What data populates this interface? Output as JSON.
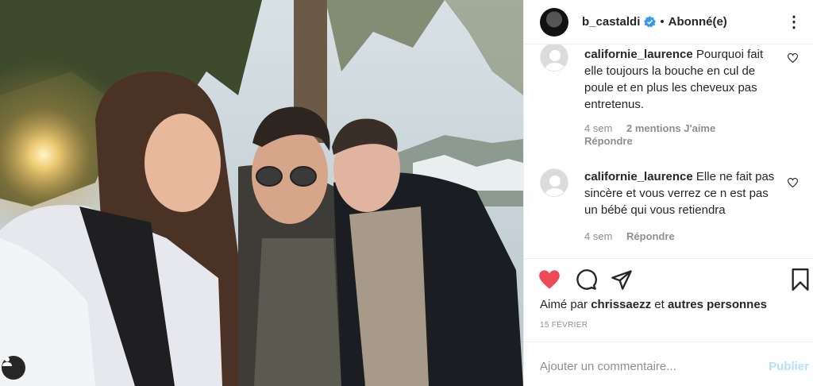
{
  "header": {
    "username": "b_castaldi",
    "separator": "•",
    "follow_label": "Abonné(e)",
    "more_label": "⋮"
  },
  "comments": [
    {
      "username": "californie_laurence",
      "text": "Pourquoi fait elle toujours la bouche en cul de poule et en plus les cheveux pas entretenus.",
      "time": "4 sem",
      "likes": "2 mentions J'aime",
      "reply_label": "Répondre"
    },
    {
      "username": "californie_laurence",
      "text": "Elle ne fait pas sincère et vous verrez ce n est pas un bébé qui vous retiendra",
      "time": "4 sem",
      "reply_label": "Répondre"
    }
  ],
  "likes_line": {
    "prefix": "Aimé par",
    "user": "chrissaezz",
    "middle": "et",
    "others": "autres personnes"
  },
  "post_date": "15 FÉVRIER",
  "add_comment": {
    "placeholder": "Ajouter un commentaire...",
    "publish_label": "Publier"
  },
  "colors": {
    "heart_liked": "#ed4956",
    "verified_badge": "#3897f0",
    "publish_disabled": "#b2dffc"
  }
}
